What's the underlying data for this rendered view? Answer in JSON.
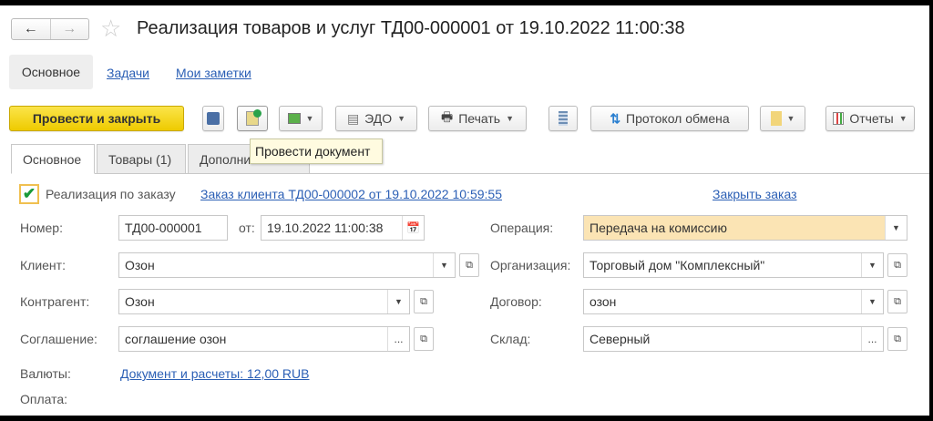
{
  "title": "Реализация товаров и услуг ТД00-000001 от 19.10.2022 11:00:38",
  "section_tabs": [
    "Основное",
    "Задачи",
    "Мои заметки"
  ],
  "toolbar": {
    "post_close": "Провести и закрыть",
    "edo": "ЭДО",
    "print": "Печать",
    "exchange_log": "Протокол обмена",
    "reports": "Отчеты"
  },
  "tooltip": "Провести документ",
  "tabs": [
    "Основное",
    "Товары (1)",
    "Дополнительно"
  ],
  "order": {
    "checkbox_label": "Реализация по заказу",
    "checked": true,
    "order_link": "Заказ клиента ТД00-000002 от 19.10.2022 10:59:55",
    "close_order": "Закрыть заказ"
  },
  "form": {
    "number_label": "Номер:",
    "number": "ТД00-000001",
    "date_label": "от:",
    "date": "19.10.2022 11:00:38",
    "client_label": "Клиент:",
    "client": "Озон",
    "counterparty_label": "Контрагент:",
    "counterparty": "Озон",
    "agreement_label": "Соглашение:",
    "agreement": "соглашение озон",
    "operation_label": "Операция:",
    "operation": "Передача на комиссию",
    "organization_label": "Организация:",
    "organization": "Торговый дом \"Комплексный\"",
    "contract_label": "Договор:",
    "contract": "озон",
    "warehouse_label": "Склад:",
    "warehouse": "Северный",
    "currency_label": "Валюты:",
    "currency_link": "Документ и расчеты: 12,00 RUB",
    "payment_label": "Оплата:"
  },
  "colors": {
    "primary_button": "#f5d516",
    "link": "#2b5fb5",
    "operation_bg": "#fbe4b4"
  }
}
